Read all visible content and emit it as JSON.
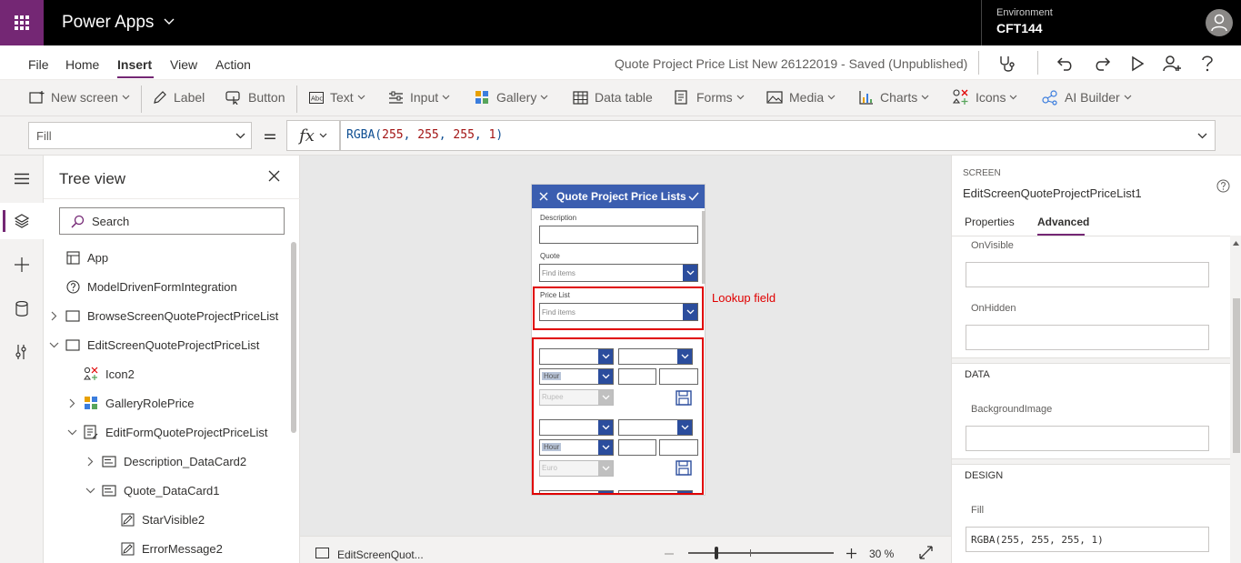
{
  "app": {
    "name": "Power Apps",
    "environment_label": "Environment",
    "environment_name": "CFT144"
  },
  "menu": {
    "tabs": [
      {
        "label": "File",
        "active": false
      },
      {
        "label": "Home",
        "active": false
      },
      {
        "label": "Insert",
        "active": true
      },
      {
        "label": "View",
        "active": false
      },
      {
        "label": "Action",
        "active": false
      }
    ],
    "save_status": "Quote Project Price List New 26122019 - Saved (Unpublished)"
  },
  "toolbar": {
    "items": [
      {
        "label": "New screen",
        "icon": "new-screen-icon",
        "dropdown": true
      },
      {
        "label": "Label",
        "icon": "label-icon",
        "dropdown": false
      },
      {
        "label": "Button",
        "icon": "button-icon",
        "dropdown": false
      },
      {
        "label": "Text",
        "icon": "text-icon",
        "dropdown": true
      },
      {
        "label": "Input",
        "icon": "input-icon",
        "dropdown": true
      },
      {
        "label": "Gallery",
        "icon": "gallery-icon",
        "dropdown": true
      },
      {
        "label": "Data table",
        "icon": "data-table-icon",
        "dropdown": false
      },
      {
        "label": "Forms",
        "icon": "forms-icon",
        "dropdown": true
      },
      {
        "label": "Media",
        "icon": "media-icon",
        "dropdown": true
      },
      {
        "label": "Charts",
        "icon": "charts-icon",
        "dropdown": true
      },
      {
        "label": "Icons",
        "icon": "icons-icon",
        "dropdown": true
      },
      {
        "label": "AI Builder",
        "icon": "ai-builder-icon",
        "dropdown": true
      }
    ]
  },
  "formula_bar": {
    "property": "Fill",
    "equals": "=",
    "fx": "fx",
    "formula_fn": "RGBA(",
    "formula_args": [
      "255",
      "255",
      "255",
      "1"
    ],
    "formula_sep": ", ",
    "formula_close": ")"
  },
  "tree": {
    "title": "Tree view",
    "search_placeholder": "Search",
    "nodes": [
      {
        "label": "App",
        "icon": "app-icon",
        "depth": 0,
        "expander": "none"
      },
      {
        "label": "ModelDrivenFormIntegration",
        "icon": "help-circle-icon",
        "depth": 0,
        "expander": "none"
      },
      {
        "label": "BrowseScreenQuoteProjectPriceList",
        "icon": "screen-icon",
        "depth": 0,
        "expander": "collapsed"
      },
      {
        "label": "EditScreenQuoteProjectPriceList",
        "icon": "screen-icon",
        "depth": 0,
        "expander": "expanded"
      },
      {
        "label": "Icon2",
        "icon": "icon-control-icon",
        "depth": 1,
        "expander": "none"
      },
      {
        "label": "GalleryRolePrice",
        "icon": "gallery-icon",
        "depth": 1,
        "expander": "collapsed"
      },
      {
        "label": "EditFormQuoteProjectPriceList",
        "icon": "form-icon",
        "depth": 1,
        "expander": "expanded"
      },
      {
        "label": "Description_DataCard2",
        "icon": "datacard-icon",
        "depth": 2,
        "expander": "collapsed"
      },
      {
        "label": "Quote_DataCard1",
        "icon": "datacard-icon",
        "depth": 2,
        "expander": "expanded"
      },
      {
        "label": "StarVisible2",
        "icon": "edit-label-icon",
        "depth": 3,
        "expander": "none"
      },
      {
        "label": "ErrorMessage2",
        "icon": "edit-label-icon",
        "depth": 3,
        "expander": "none"
      }
    ]
  },
  "canvas": {
    "screen_title": "Quote Project Price Lists",
    "description_label": "Description",
    "quote_label": "Quote",
    "quote_placeholder": "Find items",
    "price_list_label": "Price List",
    "price_list_placeholder": "Find items",
    "annotation": "Lookup field",
    "gallery_rows": [
      {
        "unit": "Hour",
        "currency": "Rupee"
      },
      {
        "unit": "Hour",
        "currency": "Euro"
      }
    ]
  },
  "bottom_bar": {
    "screen_name": "EditScreenQuot...",
    "zoom_level": 30,
    "zoom_label": "30  %"
  },
  "properties_panel": {
    "kind": "SCREEN",
    "name": "EditScreenQuoteProjectPriceList1",
    "tabs": [
      {
        "label": "Properties",
        "active": false
      },
      {
        "label": "Advanced",
        "active": true
      }
    ],
    "on_visible_label": "OnVisible",
    "on_visible_value": "",
    "on_hidden_label": "OnHidden",
    "on_hidden_value": "",
    "data_section": "DATA",
    "background_image_label": "BackgroundImage",
    "background_image_value": "",
    "design_section": "DESIGN",
    "fill_label": "Fill",
    "fill_value": "RGBA(255, 255, 255, 1)"
  },
  "colors": {
    "brand": "#742774",
    "topbar": "#000000",
    "form_header": "#3b5eb0",
    "annotation": "#e00000",
    "formula_number": "#a31515"
  }
}
